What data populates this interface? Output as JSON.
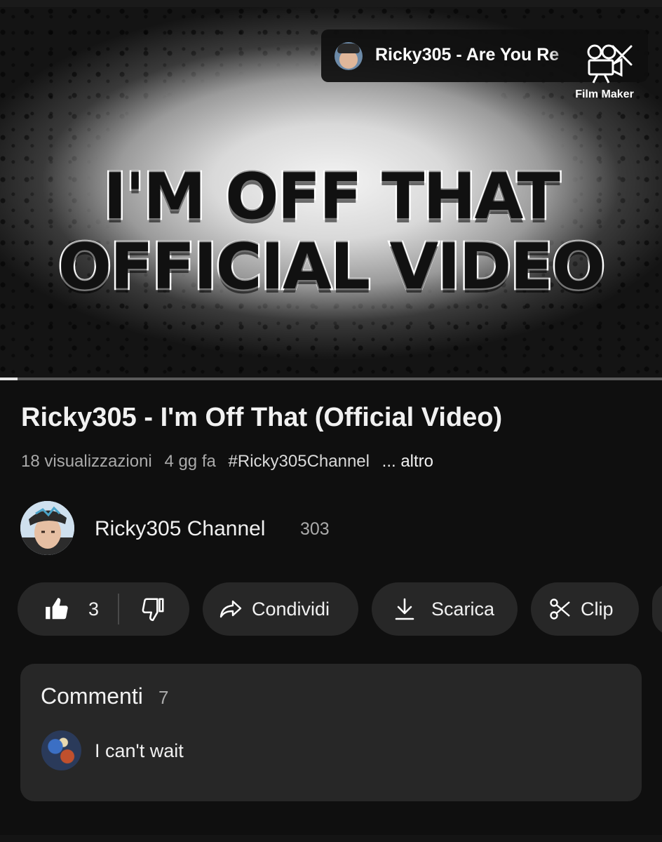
{
  "video": {
    "overlay_line1": "I'M OFF THAT",
    "overlay_line2": "OFFICIAL VIDEO",
    "watermark": "Film Maker",
    "mini_player_title": "Ricky305 - Are You Re",
    "progress_fraction": 0.027
  },
  "video_info": {
    "title": "Ricky305 - I'm Off That (Official Video)",
    "views": "18 visualizzazioni",
    "age": "4 gg fa",
    "hashtag": "#Ricky305Channel",
    "more_label": "... altro"
  },
  "channel": {
    "name": "Ricky305 Channel",
    "subscribers": "303"
  },
  "actions": {
    "like_count": "3",
    "share_label": "Condividi",
    "download_label": "Scarica",
    "clip_label": "Clip"
  },
  "comments": {
    "title": "Commenti",
    "count": "7",
    "top_comment": "I can't wait"
  },
  "icons": {
    "like": "thumbs-up-icon",
    "dislike": "thumbs-down-icon",
    "share": "share-arrow-icon",
    "download": "download-icon",
    "clip": "scissors-icon",
    "close": "close-icon",
    "camera": "movie-camera-icon"
  },
  "colors": {
    "background": "#0f0f0f",
    "pill": "#272727",
    "text_primary": "#f1f1f1",
    "text_secondary": "#aaaaaa"
  }
}
